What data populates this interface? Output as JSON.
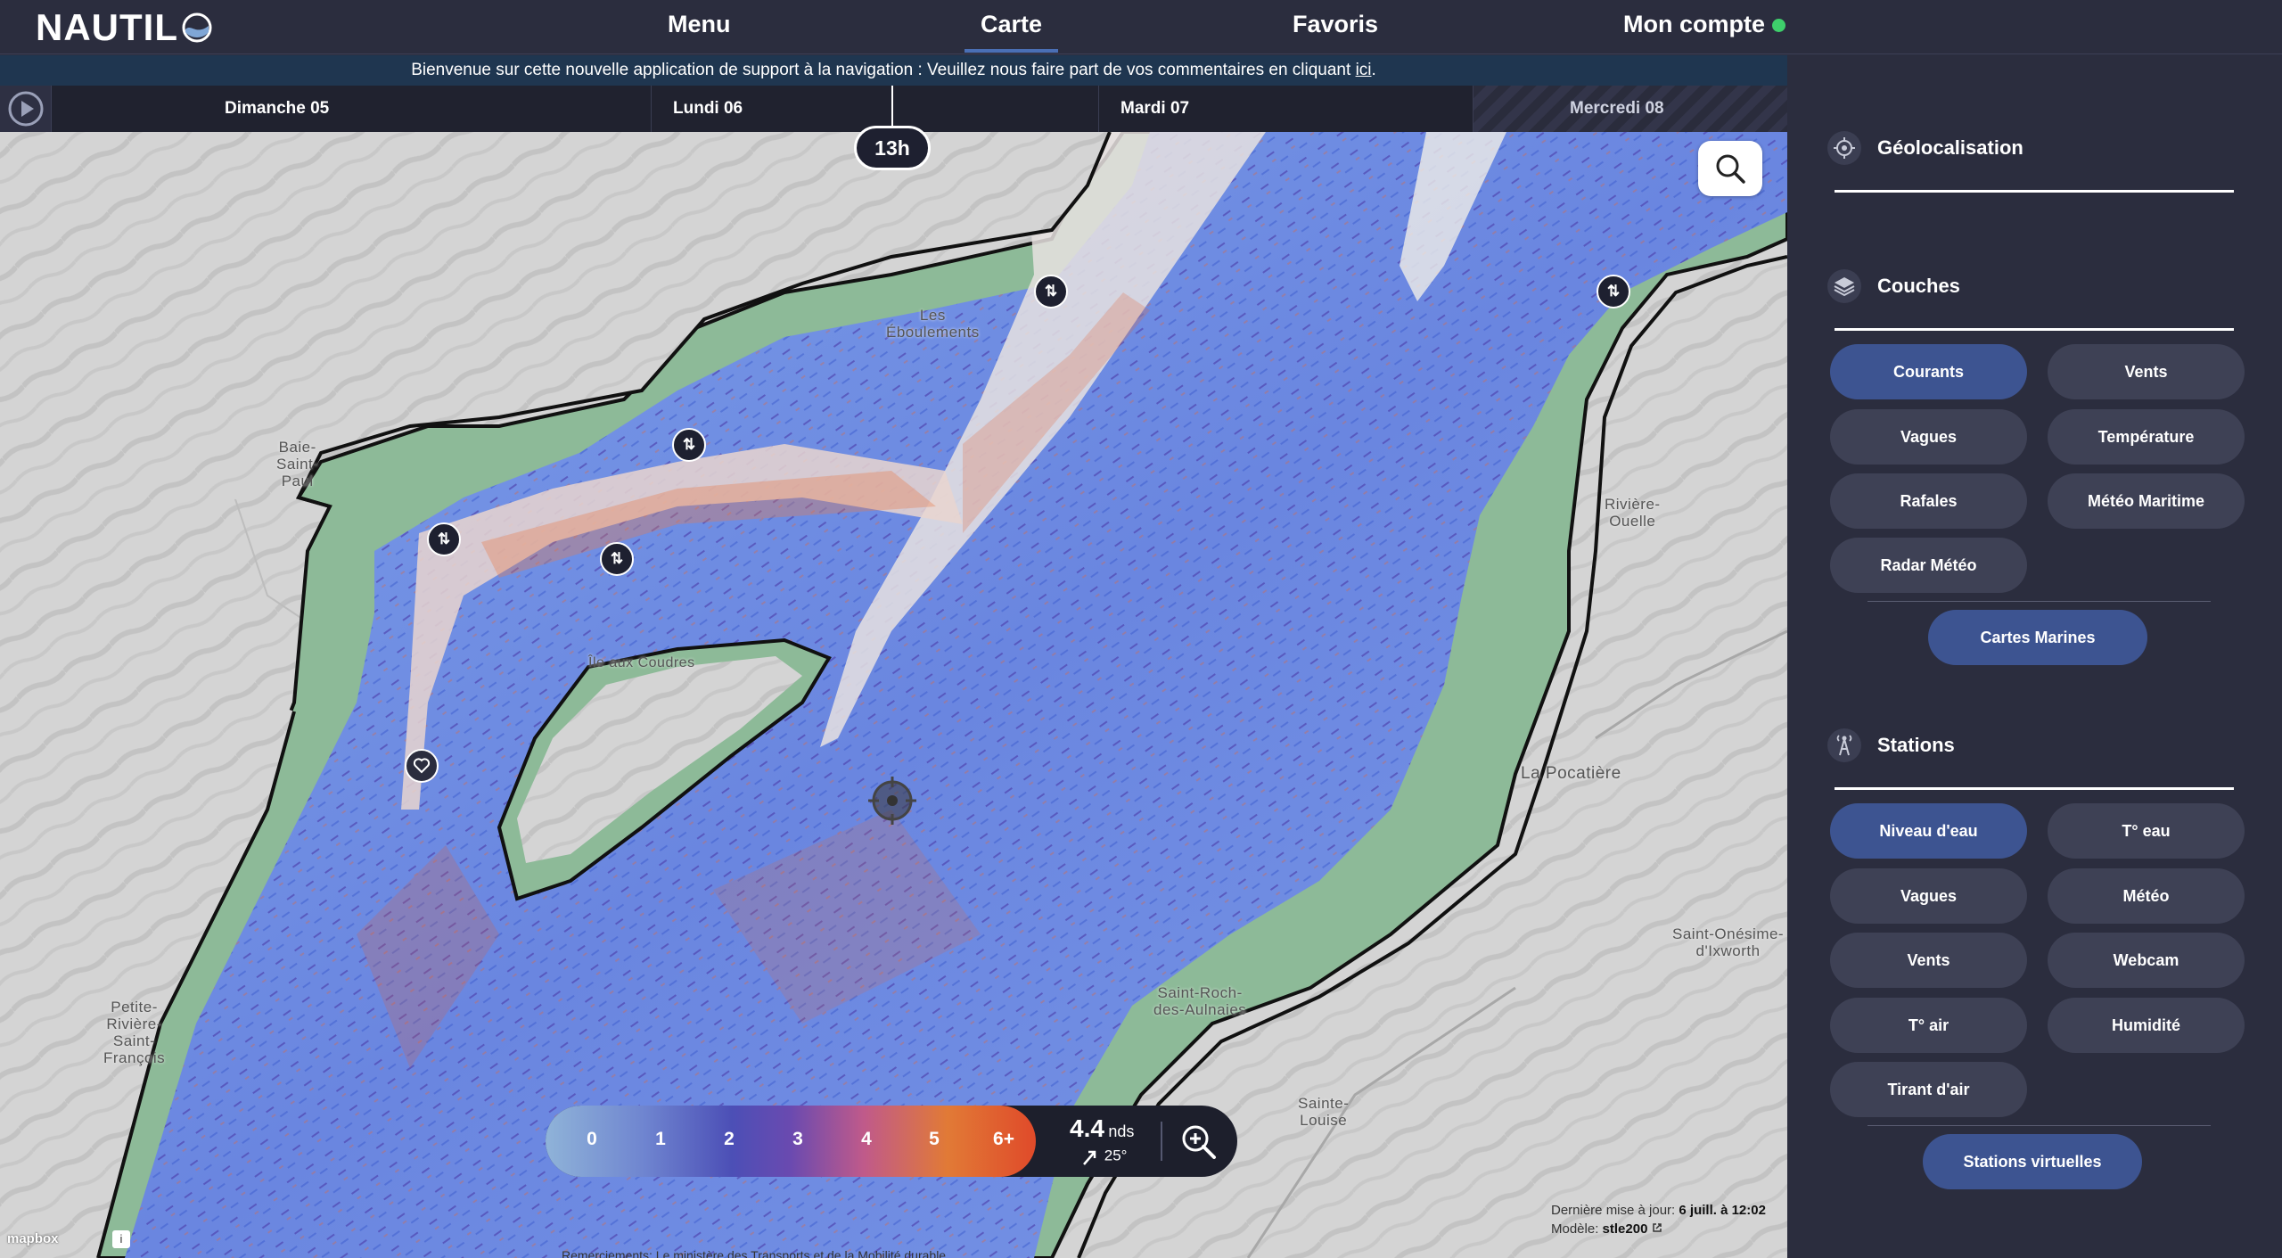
{
  "app": {
    "logo_text": "NAUTIL",
    "nav": {
      "menu": "Menu",
      "carte": "Carte",
      "favoris": "Favoris",
      "compte": "Mon compte"
    },
    "status_color": "#3ecf6b"
  },
  "announcement": {
    "text": "Bienvenue sur cette nouvelle application de support à la navigation : Veuillez nous faire part de vos commentaires en cliquant ",
    "link": "ici",
    "end": "."
  },
  "timeline": {
    "days": [
      "Dimanche 05",
      "Lundi 06",
      "Mardi 07",
      "Mercredi 08"
    ],
    "current_time": "13h"
  },
  "map": {
    "places": {
      "eboulements": "Les\nÉboulements",
      "baie_st_paul": "Baie-\nSaint-\nPaul",
      "ile_coudres": "Île aux Coudres",
      "riviere_ouelle": "Rivière-\nOuelle",
      "la_pocatiere": "La Pocatière",
      "st_onesime": "Saint-Onésime-\nd'Ixworth",
      "st_roch": "Saint-Roch-\ndes-Aulnaies",
      "ste_louise": "Sainte-\nLouise",
      "petite_riviere": "Petite-\nRivière-\nSaint-\nFrançois"
    },
    "legend": {
      "values": [
        "0",
        "1",
        "2",
        "3",
        "4",
        "5",
        "6+"
      ],
      "speed_value": "4.4",
      "speed_unit": "nds",
      "direction": "25°"
    },
    "update": {
      "label": "Dernière mise à jour:",
      "value": "6 juill. à 12:02",
      "model_label": "Modèle:",
      "model_value": "stle200"
    },
    "mapbox": "mapbox",
    "attribution": "Remerciements: Le ministère des Transports et de la Mobilité durable"
  },
  "panel": {
    "geoloc_title": "Géolocalisation",
    "layers_title": "Couches",
    "layers": [
      "Courants",
      "Vents",
      "Vagues",
      "Température",
      "Rafales",
      "Météo Maritime",
      "Radar Météo"
    ],
    "layers_extra": "Cartes Marines",
    "stations_title": "Stations",
    "stations": [
      "Niveau d'eau",
      "T° eau",
      "Vagues",
      "Météo",
      "Vents",
      "Webcam",
      "T° air",
      "Humidité",
      "Tirant d'air"
    ],
    "stations_extra": "Stations virtuelles"
  }
}
